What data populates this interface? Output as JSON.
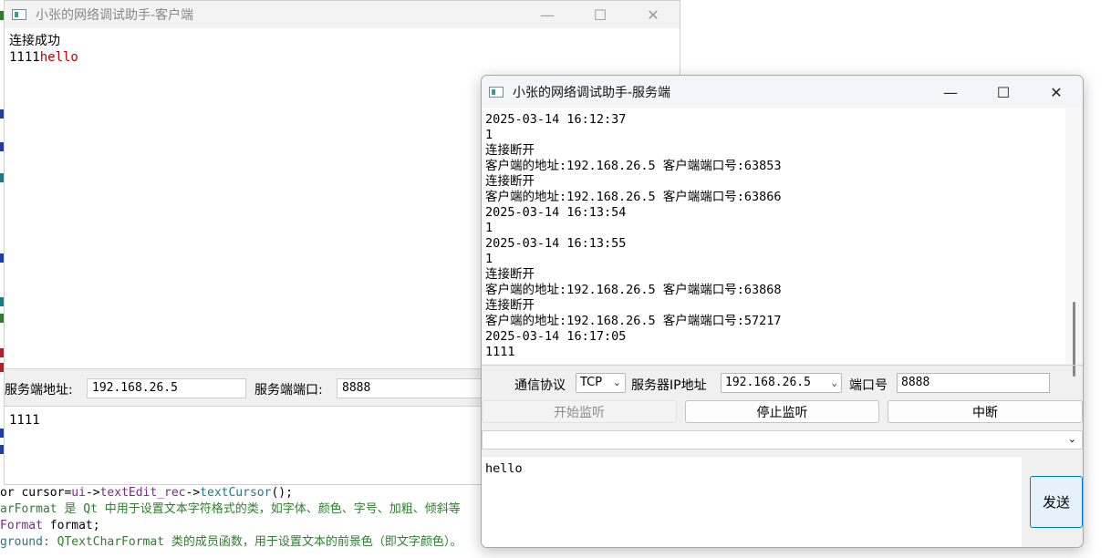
{
  "client": {
    "title": "小张的网络调试助手-客户端",
    "recv_lines": [
      {
        "text": "连接成功"
      },
      {
        "prefix": "1111",
        "suffix": "hello"
      }
    ],
    "server_addr_label": "服务端地址:",
    "server_addr_value": "192.168.26.5",
    "server_port_label": "服务端端口:",
    "server_port_value": "8888",
    "send_text": "1111"
  },
  "server": {
    "title": "小张的网络调试助手-服务端",
    "log_lines": [
      "2025-03-14 16:12:37",
      "1",
      "连接断开",
      "客户端的地址:192.168.26.5 客户端端口号:63853",
      "连接断开",
      "客户端的地址:192.168.26.5 客户端端口号:63866",
      "2025-03-14 16:13:54",
      "1",
      "2025-03-14 16:13:55",
      "1",
      "连接断开",
      "客户端的地址:192.168.26.5 客户端端口号:63868",
      "连接断开",
      "客户端的地址:192.168.26.5 客户端端口号:57217",
      "2025-03-14 16:17:05",
      "1111"
    ],
    "protocol_label": "通信协议",
    "protocol_value": "TCP",
    "ip_label": "服务器IP地址",
    "ip_value": "192.168.26.5",
    "port_label": "端口号",
    "port_value": "8888",
    "start_btn": "开始监听",
    "stop_btn": "停止监听",
    "break_btn": "中断",
    "send_text": "hello",
    "send_btn": "发送"
  },
  "background_code": [
    [
      {
        "t": "or cursor=",
        "c": ""
      },
      {
        "t": "ui",
        "c": "tok-purple"
      },
      {
        "t": "->",
        "c": ""
      },
      {
        "t": "textEdit_rec",
        "c": "tok-purple"
      },
      {
        "t": "->",
        "c": ""
      },
      {
        "t": "textCursor",
        "c": "tok-teal"
      },
      {
        "t": "();",
        "c": ""
      }
    ],
    [
      {
        "t": "arFormat 是 Qt 中用于设置文本字符格式的类，如字体、颜色、字号、加粗、倾斜等",
        "c": "tok-green"
      }
    ],
    [
      {
        "t": "Format ",
        "c": "tok-purple"
      },
      {
        "t": "format;",
        "c": ""
      }
    ],
    [
      {
        "t": "ground",
        "c": "tok-teal"
      },
      {
        "t": ": QTextCharFormat 类的成员函数，用于设置文本的前景色（即文字颜色）。",
        "c": "tok-green"
      }
    ]
  ],
  "icons": {
    "minimize": "minimize-icon",
    "maximize": "maximize-icon",
    "close": "close-icon",
    "dropdown": "chevron-down-icon"
  }
}
